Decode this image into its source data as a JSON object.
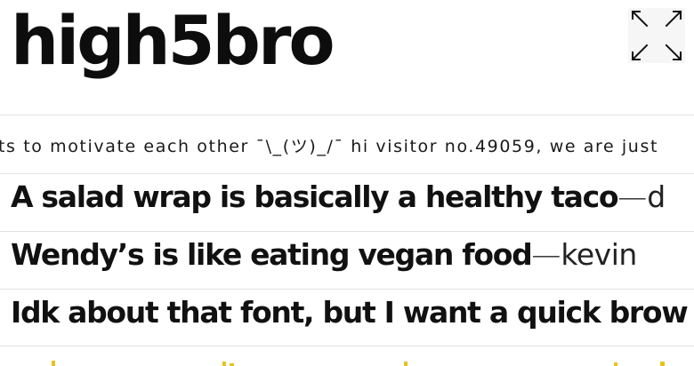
{
  "header": {
    "logo_text": "high5bro",
    "fullscreen_icon": "expand-arrows-icon"
  },
  "ticker": {
    "text": "ts to motivate each other ¯\\_(ツ)_/¯ hi visitor no.49059, we are just"
  },
  "quotes": [
    {
      "text": "A salad wrap is basically a healthy taco",
      "dash": "—",
      "author": "d"
    },
    {
      "text": "Wendy’s is like eating vegan food",
      "dash": "—",
      "author": "kevin"
    },
    {
      "text": "Idk about that font, but I want a quick brow",
      "dash": "",
      "author": ""
    }
  ],
  "colors": {
    "text": "#111111",
    "divider": "#e3e3e3",
    "partial_row_accent": "#e7c21c",
    "button_bg": "#f6f6f6"
  }
}
